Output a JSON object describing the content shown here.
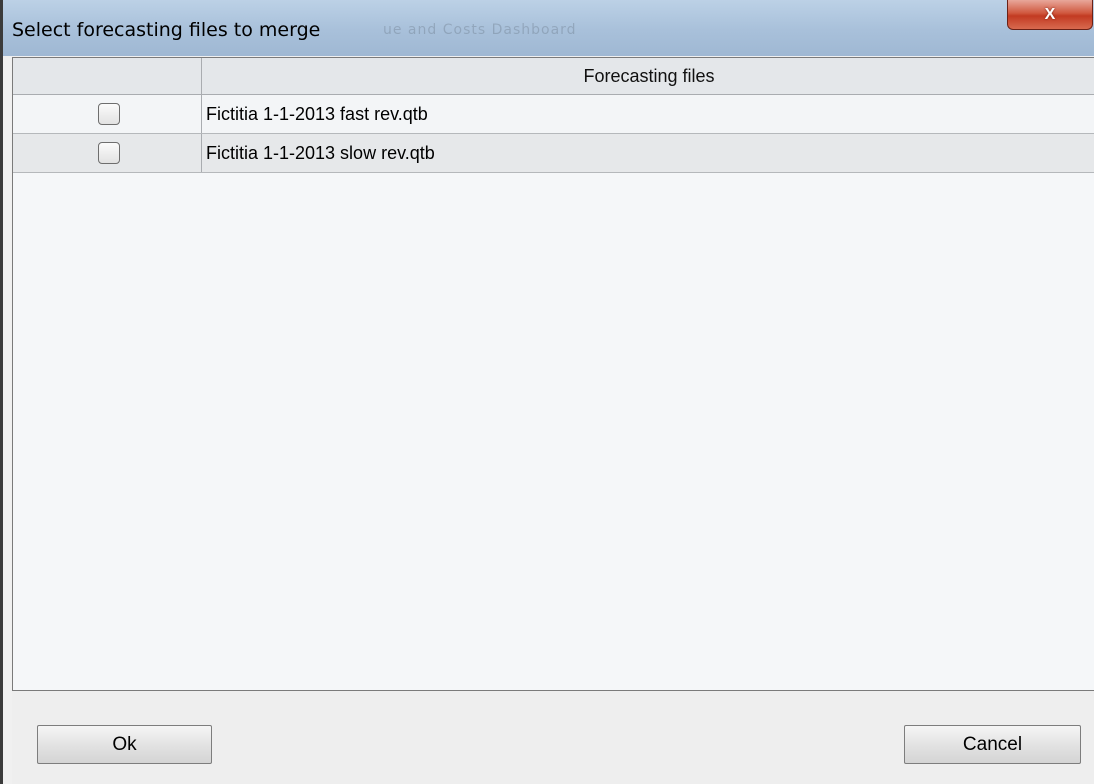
{
  "window": {
    "title": "Select forecasting files to merge",
    "background_title": "ue and Costs   Dashboard",
    "close_label": "X"
  },
  "table": {
    "columns": [
      "",
      "Forecasting files"
    ],
    "rows": [
      {
        "checked": false,
        "name": "Fictitia 1-1-2013 fast rev.qtb"
      },
      {
        "checked": false,
        "name": "Fictitia 1-1-2013 slow rev.qtb"
      }
    ]
  },
  "buttons": {
    "ok": "Ok",
    "cancel": "Cancel"
  }
}
